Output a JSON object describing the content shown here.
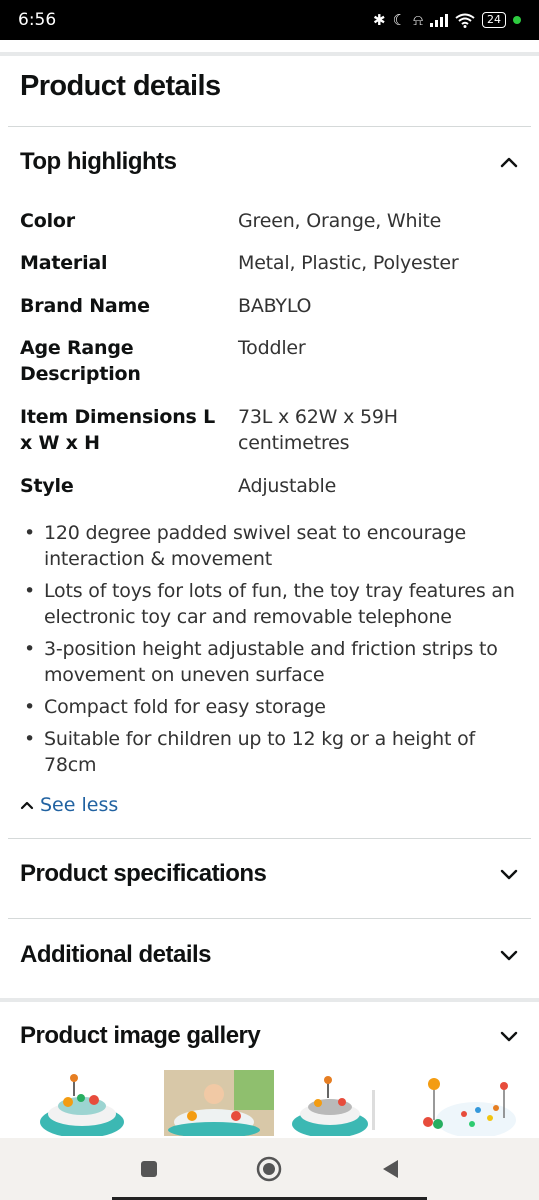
{
  "status_bar": {
    "time": "6:56",
    "battery": "24",
    "icons": [
      "bluetooth-icon",
      "moon-icon",
      "bell-off-icon",
      "signal-icon",
      "wifi-icon",
      "battery-icon"
    ]
  },
  "page": {
    "title": "Product details"
  },
  "top_highlights": {
    "title": "Top highlights",
    "attributes": [
      {
        "label": "Color",
        "value": "Green, Orange, White"
      },
      {
        "label": "Material",
        "value": "Metal, Plastic, Polyester"
      },
      {
        "label": "Brand Name",
        "value": "BABYLO"
      },
      {
        "label": "Age Range Description",
        "value": "Toddler"
      },
      {
        "label": "Item Dimensions L x W x H",
        "value": "73L x 62W x 59H centimetres"
      },
      {
        "label": "Style",
        "value": "Adjustable"
      }
    ],
    "bullets": [
      "120 degree padded swivel seat to encourage interaction & movement",
      "Lots of toys for lots of fun, the toy tray features an electronic toy car and removable telephone",
      "3-position height adjustable and friction strips to movement on uneven surface",
      "Compact fold for easy storage",
      "Suitable for children up to 12 kg or a height of 78cm"
    ],
    "see_less": "See less"
  },
  "sections": {
    "specs": "Product specifications",
    "additional": "Additional details",
    "gallery": "Product image gallery"
  },
  "colors": {
    "link": "#2162a1",
    "divider": "#e7e9ea",
    "nav_bg": "#f3f1ee"
  }
}
